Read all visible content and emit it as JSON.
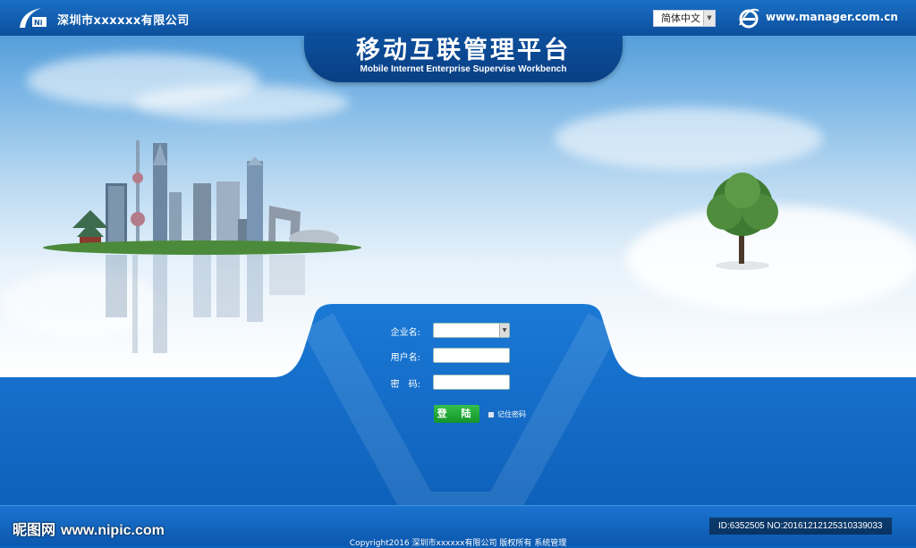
{
  "header": {
    "company_name": "深圳市xxxxxx有限公司",
    "language_selector": "简体中文",
    "site_url": "www.manager.com.cn"
  },
  "title": {
    "chinese": "移动互联管理平台",
    "english": "Mobile Internet Enterprise Supervise Workbench"
  },
  "login_form": {
    "enterprise_label": "企业名:",
    "enterprise_value": "",
    "username_label": "用户名:",
    "username_value": "",
    "password_label": "密　码:",
    "password_value": "",
    "login_button": "登 陆",
    "remember_label": "记住密码"
  },
  "footer": {
    "copyright": "Copyright2016 深圳市xxxxxx有限公司 版权所有 系统管理"
  },
  "watermark": {
    "site_name": "昵图网",
    "site_url": "www.nipic.com",
    "image_id": "ID:6352505 NO:20161212125310339033"
  },
  "colors": {
    "primary_blue": "#0c4f9c",
    "accent_green": "#13942a"
  }
}
